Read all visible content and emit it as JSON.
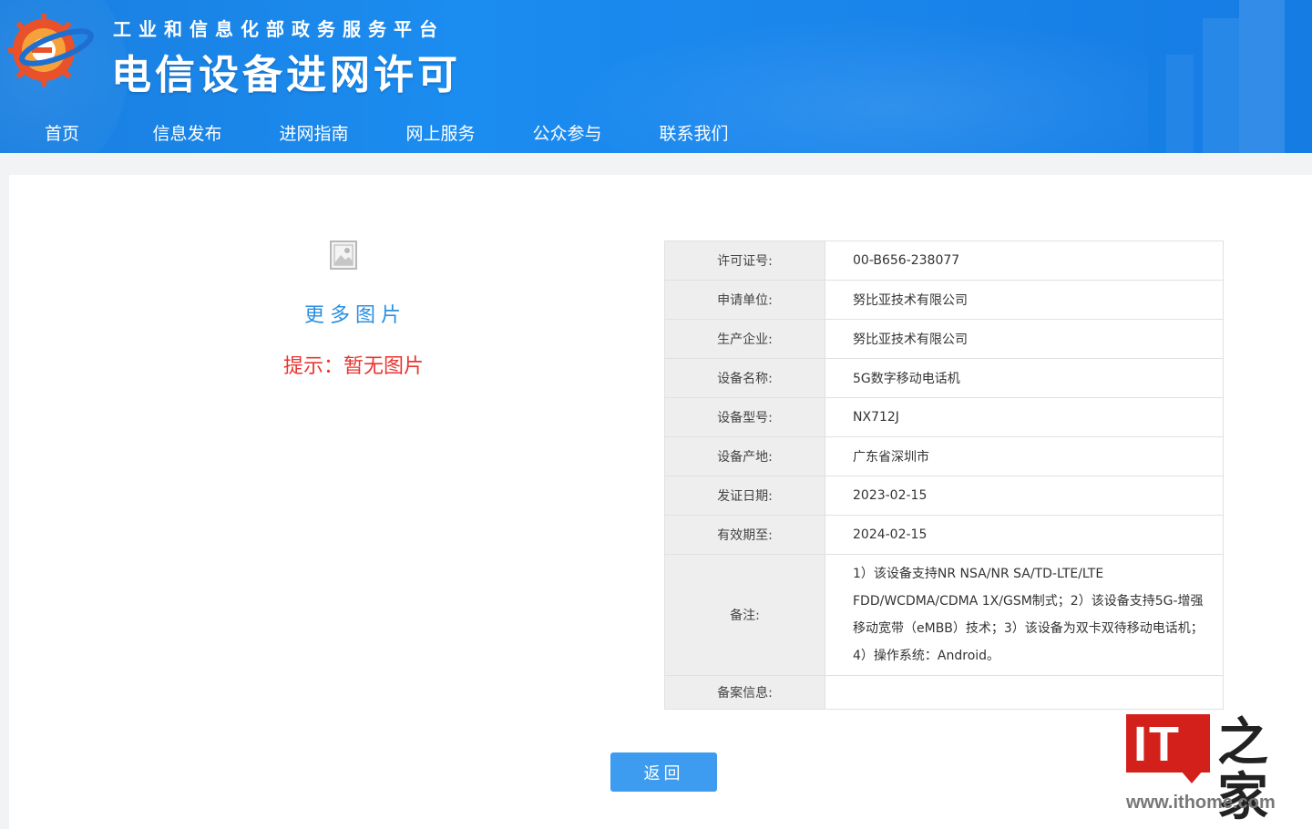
{
  "header": {
    "subtitle": "工业和信息化部政务服务平台",
    "title": "电信设备进网许可"
  },
  "nav": [
    "首页",
    "信息发布",
    "进网指南",
    "网上服务",
    "公众参与",
    "联系我们"
  ],
  "gallery": {
    "more_images": "更多图片",
    "no_image_hint": "提示：暂无图片"
  },
  "info": [
    {
      "label": "许可证号:",
      "value": "00-B656-238077"
    },
    {
      "label": "申请单位:",
      "value": "努比亚技术有限公司"
    },
    {
      "label": "生产企业:",
      "value": "努比亚技术有限公司"
    },
    {
      "label": "设备名称:",
      "value": "5G数字移动电话机"
    },
    {
      "label": "设备型号:",
      "value": "NX712J"
    },
    {
      "label": "设备产地:",
      "value": "广东省深圳市"
    },
    {
      "label": "发证日期:",
      "value": "2023-02-15"
    },
    {
      "label": "有效期至:",
      "value": "2024-02-15"
    }
  ],
  "notes": {
    "label": "备注:",
    "lines": [
      "1）该设备支持NR NSA/NR SA/TD-LTE/LTE",
      "FDD/WCDMA/CDMA 1X/GSM制式；2）该设备支持5G-增强",
      "移动宽带（eMBB）技术；3）该设备为双卡双待移动电话机；",
      "4）操作系统：Android。"
    ]
  },
  "filing": {
    "label": "备案信息:",
    "value": ""
  },
  "back_button": "返回",
  "watermark": {
    "brand": "IT",
    "home": "之家",
    "url": "www.ithome.com"
  },
  "colors": {
    "header_blue": "#1a86ec",
    "link_blue": "#2a8fe0",
    "hint_red": "#e8352f",
    "button_blue": "#3d9cf0"
  }
}
